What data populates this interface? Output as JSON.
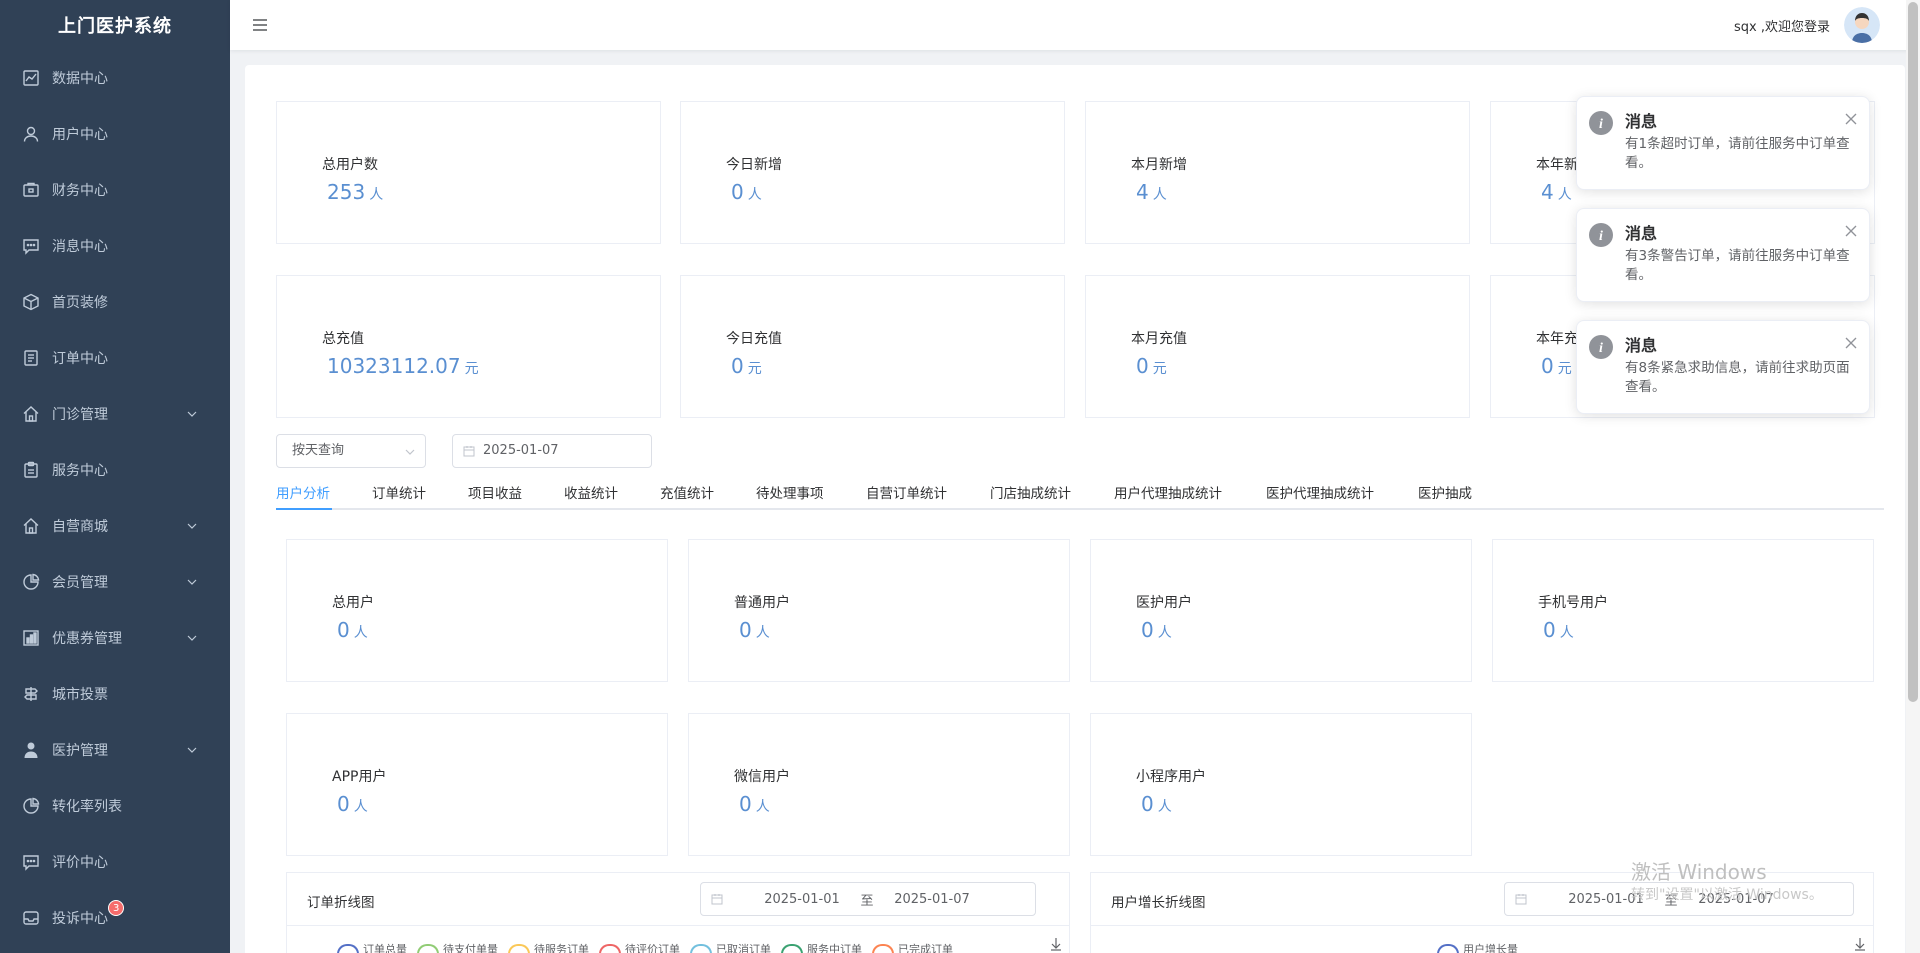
{
  "app": {
    "title": "上门医护系统"
  },
  "topbar": {
    "welcome": "sqx ,欢迎您登录"
  },
  "sidebar": {
    "items": [
      {
        "label": "数据中心",
        "icon": "chart-icon",
        "expandable": false
      },
      {
        "label": "用户中心",
        "icon": "user-icon",
        "expandable": false
      },
      {
        "label": "财务中心",
        "icon": "wallet-icon",
        "expandable": false
      },
      {
        "label": "消息中心",
        "icon": "message-icon",
        "expandable": false
      },
      {
        "label": "首页装修",
        "icon": "box-icon",
        "expandable": false
      },
      {
        "label": "订单中心",
        "icon": "document-icon",
        "expandable": false
      },
      {
        "label": "门诊管理",
        "icon": "home-icon",
        "expandable": true
      },
      {
        "label": "服务中心",
        "icon": "clipboard-icon",
        "expandable": false
      },
      {
        "label": "自营商城",
        "icon": "home-icon",
        "expandable": true
      },
      {
        "label": "会员管理",
        "icon": "pie-icon",
        "expandable": true
      },
      {
        "label": "优惠券管理",
        "icon": "coupon-icon",
        "expandable": true
      },
      {
        "label": "城市投票",
        "icon": "vote-icon",
        "expandable": false
      },
      {
        "label": "医护管理",
        "icon": "nurse-icon",
        "expandable": true
      },
      {
        "label": "转化率列表",
        "icon": "pie-icon",
        "expandable": false
      },
      {
        "label": "评价中心",
        "icon": "message-icon",
        "expandable": false
      },
      {
        "label": "投诉中心",
        "icon": "inbox-icon",
        "expandable": false,
        "badge": "3"
      }
    ]
  },
  "summary": {
    "row1": [
      {
        "label": "总用户数",
        "value": "253",
        "unit": "人"
      },
      {
        "label": "今日新增",
        "value": "0",
        "unit": "人"
      },
      {
        "label": "本月新增",
        "value": "4",
        "unit": "人"
      },
      {
        "label": "本年新",
        "value": "4",
        "unit": "人"
      }
    ],
    "row2": [
      {
        "label": "总充值",
        "value": "10323112.07",
        "unit": "元"
      },
      {
        "label": "今日充值",
        "value": "0",
        "unit": "元"
      },
      {
        "label": "本月充值",
        "value": "0",
        "unit": "元"
      },
      {
        "label": "本年充",
        "value": "0",
        "unit": "元"
      }
    ]
  },
  "filters": {
    "mode": "按天查询",
    "date": "2025-01-07"
  },
  "tabs": [
    "用户分析",
    "订单统计",
    "项目收益",
    "收益统计",
    "充值统计",
    "待处理事项",
    "自营订单统计",
    "门店抽成统计",
    "用户代理抽成统计",
    "医护代理抽成统计",
    "医护抽成"
  ],
  "user_stats": {
    "row1": [
      {
        "label": "总用户",
        "value": "0",
        "unit": "人"
      },
      {
        "label": "普通用户",
        "value": "0",
        "unit": "人"
      },
      {
        "label": "医护用户",
        "value": "0",
        "unit": "人"
      },
      {
        "label": "手机号用户",
        "value": "0",
        "unit": "人"
      }
    ],
    "row2": [
      {
        "label": "APP用户",
        "value": "0",
        "unit": "人"
      },
      {
        "label": "微信用户",
        "value": "0",
        "unit": "人"
      },
      {
        "label": "小程序用户",
        "value": "0",
        "unit": "人"
      }
    ]
  },
  "charts": {
    "order": {
      "title": "订单折线图",
      "start": "2025-01-01",
      "sep": "至",
      "end": "2025-01-07",
      "legend": [
        {
          "name": "订单总量",
          "color": "#5470c6"
        },
        {
          "name": "待支付单量",
          "color": "#91cc75"
        },
        {
          "name": "待服务订单",
          "color": "#fac858"
        },
        {
          "name": "待评价订单",
          "color": "#ee6666"
        },
        {
          "name": "已取消订单",
          "color": "#73c0de"
        },
        {
          "name": "服务中订单",
          "color": "#3ba272"
        },
        {
          "name": "已完成订单",
          "color": "#fc8452"
        }
      ]
    },
    "user": {
      "title": "用户增长折线图",
      "start": "2025-01-01",
      "sep": "至",
      "end": "2025-01-07",
      "legend": [
        {
          "name": "用户增长量",
          "color": "#5470c6"
        }
      ]
    }
  },
  "notifications": [
    {
      "title": "消息",
      "message": "有1条超时订单，请前往服务中订单查看。"
    },
    {
      "title": "消息",
      "message": "有3条警告订单，请前往服务中订单查看。"
    },
    {
      "title": "消息",
      "message": "有8条紧急求助信息，请前往求助页面查看。"
    }
  ],
  "watermark": {
    "line1": "激活 Windows",
    "line2": "转到\"设置\"以激活 Windows。"
  }
}
